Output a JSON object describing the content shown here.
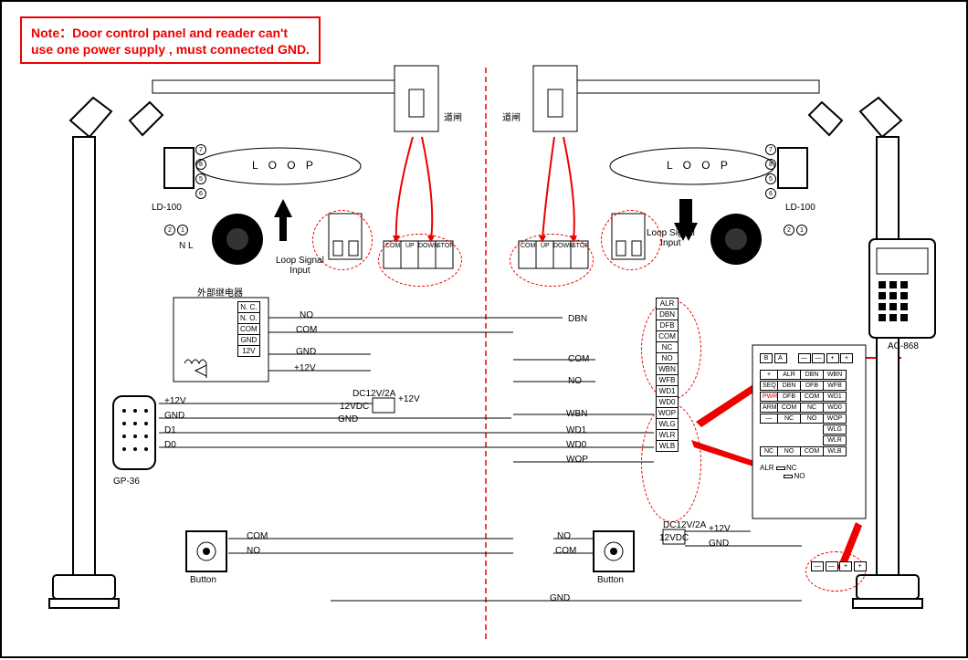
{
  "note": "Note：Door control panel and  reader can't\nuse one power supply , must connected GND.",
  "left": {
    "loop_label": "L O O P",
    "ld100_label": "LD-100",
    "gate_label": "道闸",
    "nl_label": "N  L",
    "loop_signal": "Loop Signal\nInput",
    "relay_title": "外部继电器",
    "relay_pins": [
      "N. C.",
      "N. O.",
      "COM",
      "GND",
      "12V"
    ],
    "relay_wires": [
      "NO",
      "COM",
      "GND",
      "+12V"
    ],
    "psu_top": "DC12V/2A",
    "psu_mid": "12VDC",
    "psu_plus12": "+12V",
    "psu_gnd": "GND",
    "gp36": "GP-36",
    "gp36_wires": [
      "+12V",
      "GND",
      "D1",
      "D0"
    ],
    "button_label": "Button",
    "button_wires": [
      "COM",
      "NO"
    ],
    "gate_terms": [
      "COM",
      "UP",
      "DOWN",
      "STOP"
    ]
  },
  "right": {
    "loop_label": "L O O P",
    "ld100_label": "LD-100",
    "gate_label": "道闸",
    "loop_signal": "Loop Signal\nInput",
    "gate_terms": [
      "COM",
      "UP",
      "DOWN",
      "STOP"
    ],
    "wiegand_bus": [
      "DBN",
      "COM",
      "NO",
      "WBN",
      "WD1",
      "WD0",
      "WOP"
    ],
    "block_a": [
      "ALR",
      "DBN",
      "DFB",
      "COM",
      "NC",
      "NO",
      "WBN",
      "WFB",
      "WD1",
      "WD0",
      "WOP",
      "WLG",
      "WLR",
      "WLB"
    ],
    "panel_row1": [
      "B",
      "A",
      "—",
      "—",
      "+",
      "+"
    ],
    "panel_row2a": [
      "+",
      "ALR",
      "DBN",
      "WBN"
    ],
    "panel_row2b": [
      "SEQ",
      "DBN",
      "DFB",
      "WFB"
    ],
    "panel_row2c": [
      "PWR",
      "DFB",
      "COM",
      "WD1"
    ],
    "panel_row2d": [
      "ARM",
      "COM",
      "NC",
      "WD0"
    ],
    "panel_row2e": [
      "—",
      "NC",
      "NO",
      "WOP"
    ],
    "panel_row2f": [
      "",
      "",
      "",
      "WLG"
    ],
    "panel_row2g": [
      "",
      "",
      "",
      "WLR"
    ],
    "panel_row2h": [
      "NC",
      "NO",
      "COM",
      "WLB"
    ],
    "panel_alr": "ALR",
    "panel_alr_nc": "NC",
    "panel_alr_no": "NO",
    "psu_top": "DC12V/2A",
    "psu_mid": "12VDC",
    "psu_plus12": "+12V",
    "psu_gnd": "GND",
    "button_label": "Button",
    "button_wires": [
      "NO",
      "COM"
    ],
    "ac868": "AC-868",
    "bottom_gnd": "GND",
    "pwr_strip": [
      "—",
      "—",
      "+",
      "+"
    ]
  },
  "pin_nums": [
    "1",
    "2",
    "5",
    "6",
    "7",
    "8"
  ]
}
